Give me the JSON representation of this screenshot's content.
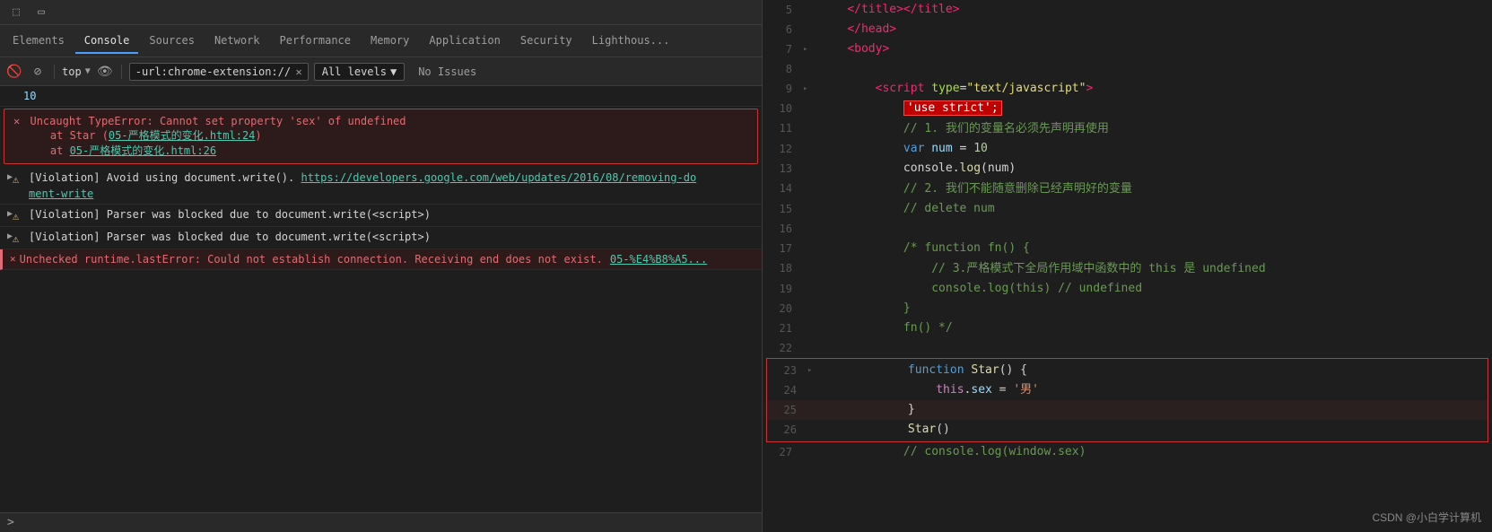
{
  "devtools": {
    "tabs": [
      {
        "label": "Elements",
        "active": false
      },
      {
        "label": "Console",
        "active": true
      },
      {
        "label": "Sources",
        "active": false
      },
      {
        "label": "Network",
        "active": false
      },
      {
        "label": "Performance",
        "active": false
      },
      {
        "label": "Memory",
        "active": false
      },
      {
        "label": "Application",
        "active": false
      },
      {
        "label": "Security",
        "active": false
      },
      {
        "label": "Lighthous...",
        "active": false
      }
    ],
    "toolbar": {
      "context_label": "top",
      "filter_placeholder": "-url:chrome-extension://jgphnjokjhjl",
      "levels_label": "All levels",
      "levels_arrow": "▼",
      "no_issues": "No Issues"
    },
    "console_output": [
      {
        "type": "number",
        "text": "10"
      },
      {
        "type": "error_block",
        "main": "Uncaught TypeError: Cannot set property 'sex' of undefined",
        "stack": [
          {
            "text": "at Star (",
            "link": "05-严格模式的变化.html:24",
            "href": "#"
          },
          {
            "text": "at ",
            "link": "05-严格模式的变化.html:26",
            "href": "#"
          }
        ]
      },
      {
        "type": "violation",
        "icon": "warning",
        "expandable": true,
        "text_before": "[Violation] Avoid using document.write(). ",
        "link": "https://developers.google.com/web/updates/2016/08/removing-document-write",
        "link_short": "https://developers.google.com/web/updates/2016/08/removing-do\nment-write",
        "text_after": ""
      },
      {
        "type": "violation",
        "icon": "warning",
        "expandable": true,
        "text": "[Violation] Parser was blocked due to document.write(<script>)"
      },
      {
        "type": "violation",
        "icon": "warning",
        "expandable": true,
        "text": "[Violation] Parser was blocked due to document.write(<script>)"
      },
      {
        "type": "unchecked_error",
        "text": "Unchecked runtime.lastError: Could not establish connection. Receiving end does not exist.",
        "link": "05-%E4%B8%A5...",
        "href": "#"
      }
    ]
  },
  "editor": {
    "lines": [
      {
        "num": 5,
        "arrow": "",
        "content": "    </title></title>",
        "type": "html_tag"
      },
      {
        "num": 6,
        "arrow": "",
        "content": "    </head>",
        "type": "html_tag"
      },
      {
        "num": 7,
        "arrow": "◦",
        "content": "    <body>",
        "type": "html_tag"
      },
      {
        "num": 8,
        "arrow": "",
        "content": "",
        "type": "blank"
      },
      {
        "num": 9,
        "arrow": "◦",
        "content": "        <script type=\"text/javascript\">",
        "type": "html_tag"
      },
      {
        "num": 10,
        "arrow": "",
        "content": "            'use strict';",
        "type": "code_highlighted"
      },
      {
        "num": 11,
        "arrow": "",
        "content": "            // 1. 我们的变量名必须先声明再使用",
        "type": "comment"
      },
      {
        "num": 12,
        "arrow": "",
        "content": "            var num = 10",
        "type": "code"
      },
      {
        "num": 13,
        "arrow": "",
        "content": "            console.log(num)",
        "type": "code"
      },
      {
        "num": 14,
        "arrow": "",
        "content": "            // 2. 我们不能随意删除已经声明好的变量",
        "type": "comment"
      },
      {
        "num": 15,
        "arrow": "",
        "content": "            // delete num",
        "type": "comment"
      },
      {
        "num": 16,
        "arrow": "",
        "content": "",
        "type": "blank"
      },
      {
        "num": 17,
        "arrow": "",
        "content": "            /* function fn() {",
        "type": "comment"
      },
      {
        "num": 18,
        "arrow": "",
        "content": "                // 3.严格模式下全局作用域中函数中的 this 是 undefined",
        "type": "comment"
      },
      {
        "num": 19,
        "arrow": "",
        "content": "                console.log(this) // undefined",
        "type": "comment"
      },
      {
        "num": 20,
        "arrow": "",
        "content": "            }",
        "type": "comment"
      },
      {
        "num": 21,
        "arrow": "",
        "content": "            fn() */",
        "type": "comment"
      },
      {
        "num": 22,
        "arrow": "",
        "content": "",
        "type": "blank"
      },
      {
        "num": 23,
        "arrow": "◦",
        "content": "            function Star() {",
        "type": "code_error_box"
      },
      {
        "num": 24,
        "arrow": "",
        "content": "                this.sex = '男'",
        "type": "code_error_box"
      },
      {
        "num": 25,
        "arrow": "",
        "content": "            }",
        "type": "code_error_box"
      },
      {
        "num": 26,
        "arrow": "",
        "content": "            Star()",
        "type": "code_error_box_last"
      },
      {
        "num": 27,
        "arrow": "",
        "content": "            // console.log(window.sex)",
        "type": "comment"
      }
    ],
    "watermark": "CSDN @小白学计算机"
  }
}
